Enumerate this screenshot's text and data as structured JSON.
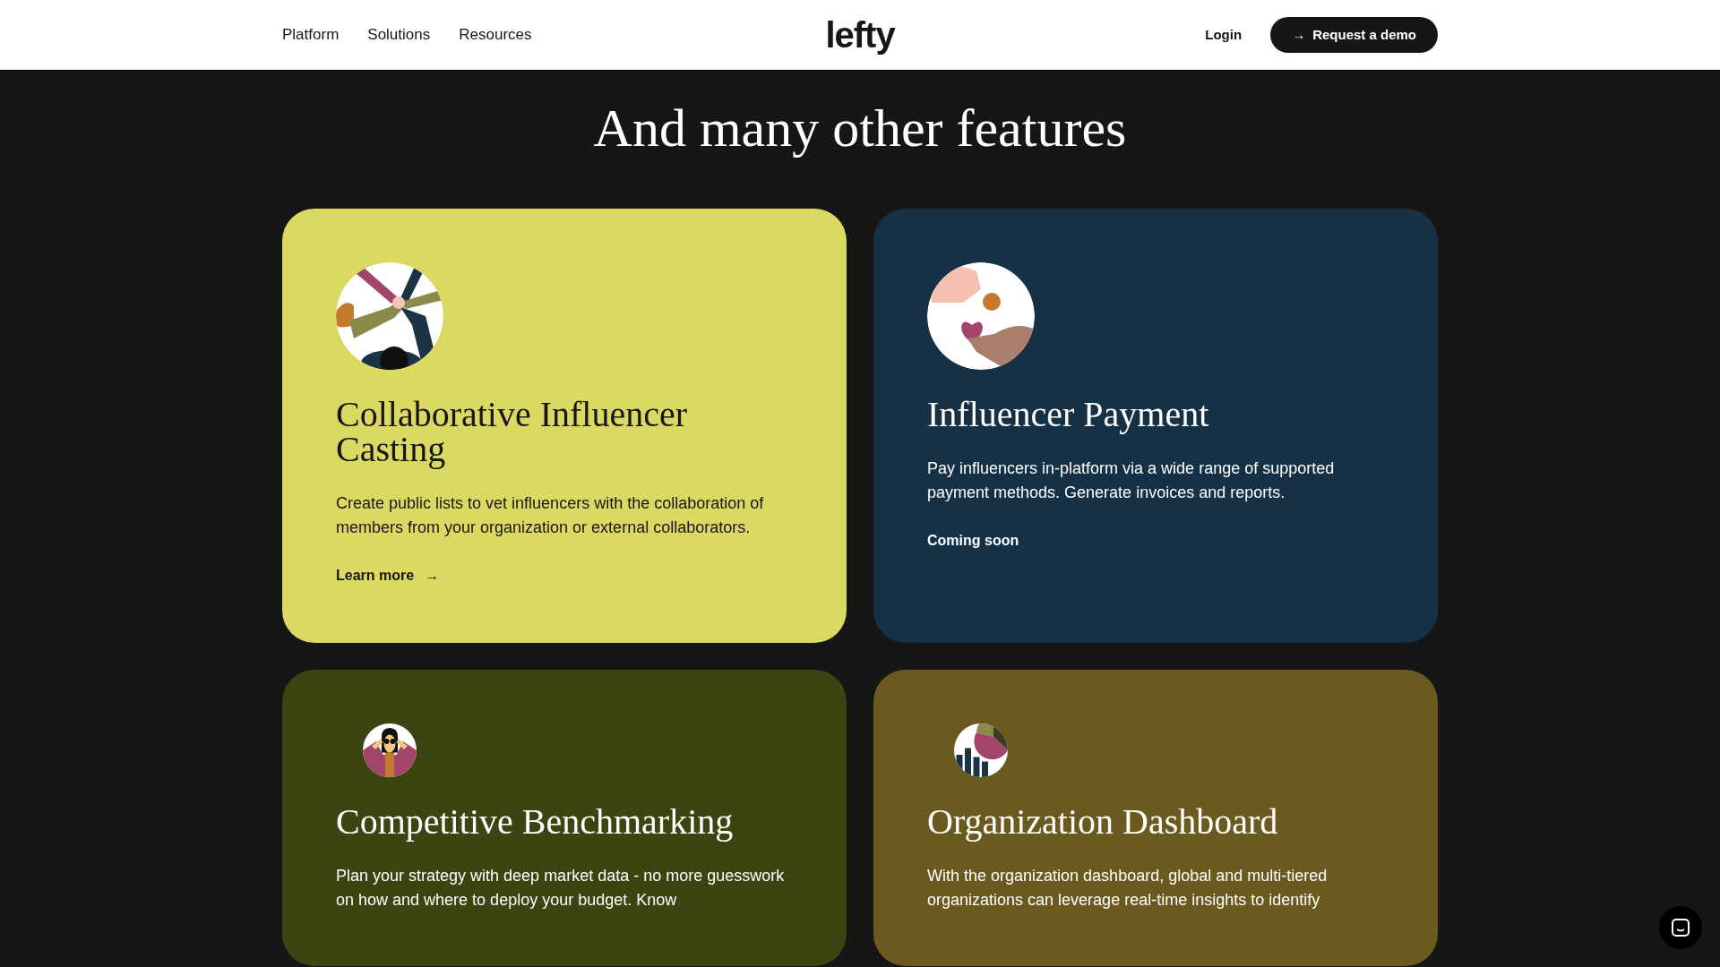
{
  "header": {
    "nav": [
      "Platform",
      "Solutions",
      "Resources"
    ],
    "logo": "lefty",
    "login": "Login",
    "cta": {
      "icon": "→",
      "label": "Request a demo"
    }
  },
  "heading": "And many other features",
  "cards": [
    {
      "kind": "casting",
      "color": "#dcd963",
      "title": "Collaborative Influencer Casting",
      "description": "Create public lists to vet influencers with the collaboration of members from your organization or external collaborators.",
      "footer": {
        "kind": "link",
        "label": "Learn more",
        "icon": "→"
      }
    },
    {
      "kind": "payment",
      "color": "#163145",
      "title": "Influencer Payment",
      "description": "Pay influencers in-platform via a wide range of supported payment methods. Generate invoices and reports.",
      "footer": {
        "kind": "note",
        "label": "Coming soon"
      }
    },
    {
      "kind": "benchmark",
      "color": "#3b4512",
      "title": "Competitive Benchmarking",
      "description": "Plan your strategy with deep market data - no more guesswork on how and where to deploy your budget. Know"
    },
    {
      "kind": "dashboard",
      "color": "#6b5a20",
      "title": "Organization Dashboard",
      "description": "With the organization dashboard, global and multi-tiered organizations can leverage real-time insights to identify"
    }
  ]
}
